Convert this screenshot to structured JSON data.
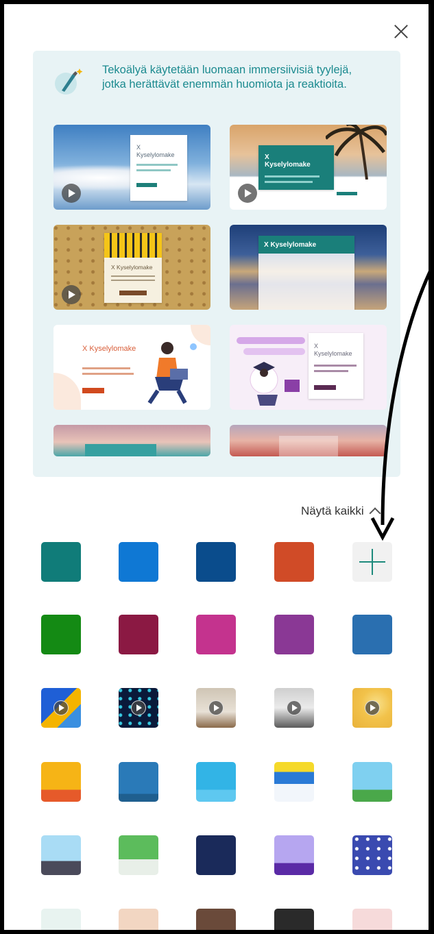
{
  "ai_banner": {
    "text": "Tekoälyä käytetään luomaan immersiivisiä tyylejä, jotka herättävät enemmän huomiota ja reaktioita.",
    "icon": "brush-sparkle-icon"
  },
  "templates": [
    {
      "title": "X\nKyselylomake",
      "theme": "sky-clouds",
      "has_video": true
    },
    {
      "title": "X\nKyselylomake",
      "theme": "beach-palm",
      "has_video": true
    },
    {
      "title": "X Kyselylomake",
      "theme": "gold-confetti",
      "has_video": true
    },
    {
      "title": "X Kyselylomake",
      "theme": "night-city",
      "has_video": false
    },
    {
      "title": "X Kyselylomake",
      "theme": "illustration-person",
      "has_video": false
    },
    {
      "title": "X\nKyselylomake",
      "theme": "illustration-pink",
      "has_video": false
    }
  ],
  "show_all_label": "Näytä kaikki",
  "swatch_colors": [
    "#107c79",
    "#0f78d4",
    "#0a4c8c",
    "#d04b27",
    "add",
    "#148a14",
    "#8b1943",
    "#c4338e",
    "#8a3895",
    "#2a6fb0"
  ],
  "colors": {
    "accent": "#1b8a8f",
    "panel_bg": "#e8f3f5"
  }
}
